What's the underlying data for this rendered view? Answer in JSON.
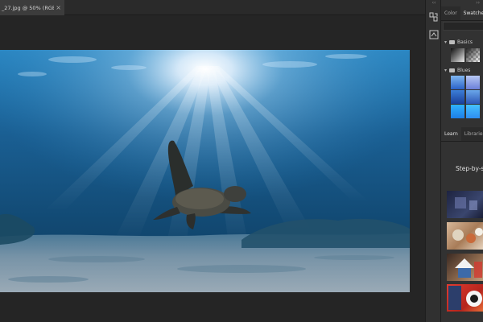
{
  "document": {
    "tab_title": "_27.jpg @ 50% (RGB/8#)",
    "close_glyph": "×"
  },
  "icon_strip": {
    "collapse_glyph": "‹‹",
    "buttons": [
      "history-icon",
      "adjustments-icon"
    ]
  },
  "panels": {
    "collapse_glyph": "››",
    "top_tabs": [
      "Color",
      "Swatches"
    ],
    "swatch_groups": [
      {
        "label": "Basics"
      },
      {
        "label": "Blues"
      }
    ],
    "bottom_tabs": [
      "Learn",
      "Libraries"
    ],
    "learn": {
      "subtitle": "Step-by-s"
    }
  },
  "colors": {
    "app_bg": "#252525",
    "panel_bg": "#323232",
    "water_top": "#1c6fa8",
    "water_deep": "#0c3557",
    "sand": "#7893a6"
  }
}
